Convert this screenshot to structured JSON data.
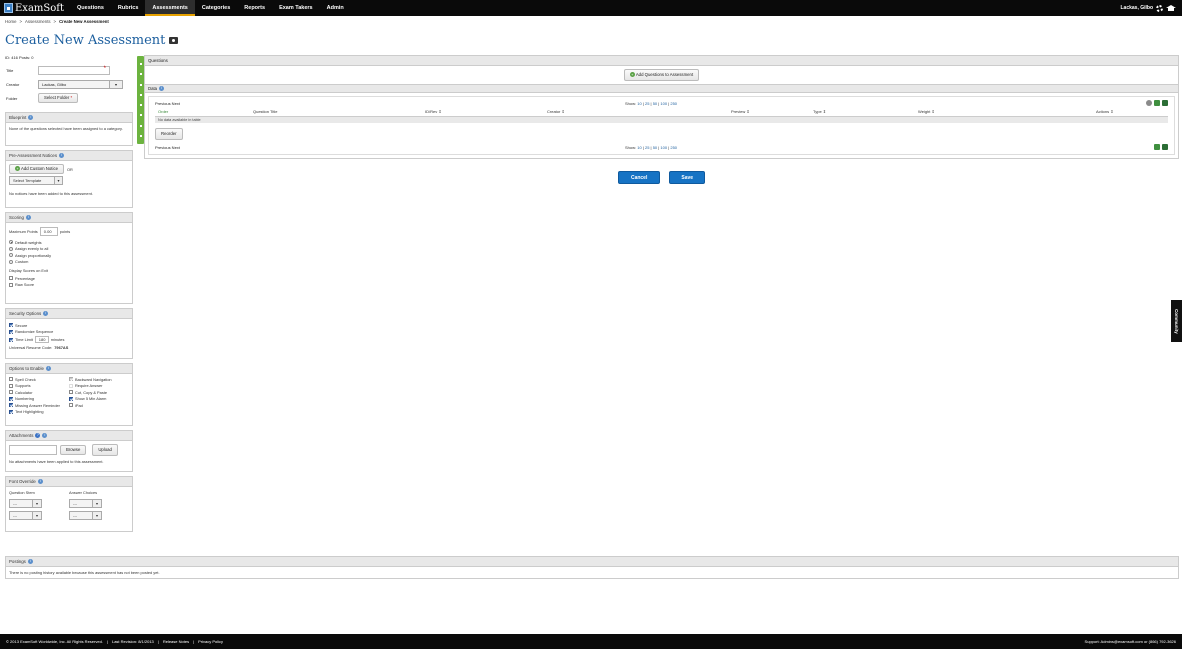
{
  "app": {
    "name": "ExamSoft"
  },
  "nav": [
    "Questions",
    "Rubrics",
    "Assessments",
    "Categories",
    "Reports",
    "Exam Takers",
    "Admin"
  ],
  "user": {
    "name": "Lackas, Gilbo"
  },
  "breadcrumb": {
    "home": "Home",
    "sep": ">",
    "assessments": "Assessments",
    "current": "Create New Assessment"
  },
  "page": {
    "title": "Create New Assessment"
  },
  "form": {
    "id_line": "ID: 416  Posts: 0",
    "title_label": "Title",
    "title_value": "",
    "creator_label": "Creator",
    "creator_value": "Lackas, Gilbo",
    "folder_label": "Folder",
    "folder_button": "Select Folder"
  },
  "blueprint": {
    "title": "Blueprint",
    "text": "None of the questions selected have been assigned to a category."
  },
  "notices": {
    "title": "Pre-Assessment Notices",
    "add_button": "Add Custom Notice",
    "or": "OR",
    "template": "Select Template",
    "empty": "No notices have been added to this assessment."
  },
  "scoring": {
    "title": "Scoring",
    "max_label": "Maximum Points",
    "max_value": "0.00",
    "points": "points",
    "radios": [
      "Default weights",
      "Assign evenly to all",
      "Assign proportionally",
      "Custom"
    ],
    "display_label": "Display Scores on Exit",
    "checks": [
      "Percentage",
      "Raw Score"
    ]
  },
  "security": {
    "title": "Security Options",
    "secure": "Secure",
    "randomize": "Randomize Sequence",
    "time_limit": "Time Limit",
    "time_value": "180",
    "minutes": "minutes",
    "resume_label": "Universal Resume Code:",
    "resume_code": "7967AS"
  },
  "enable": {
    "title": "Options to Enable",
    "left": [
      "Spell Check",
      "Supports",
      "Calculator",
      "Numbering",
      "Missing Answer Reminder",
      "Text Highlighting"
    ],
    "right": [
      "Backward Navigation",
      "Require Answer",
      "Cut, Copy & Paste",
      "Show 5 Min Alarm",
      "iPad"
    ]
  },
  "attachments": {
    "title": "Attachments",
    "browse": "Browse",
    "upload": "Upload",
    "empty": "No attachments have been applied to this assessment."
  },
  "font": {
    "title": "Font Override",
    "question_stem": "Question Stem",
    "answer_choices": "Answer Choices",
    "dash": "---"
  },
  "questions": {
    "title": "Questions",
    "add_button": "Add Questions to Assessment",
    "data_title": "Data",
    "pager": "Previous Next",
    "show_label": "Show:",
    "show_options": [
      "10",
      "25",
      "50",
      "100",
      "250"
    ],
    "columns": [
      "Order",
      "Question Title",
      "ID/Rev",
      "Creator",
      "Preview",
      "Type",
      "Weight",
      "Actions"
    ],
    "empty": "No data available in table",
    "reorder": "Reorder"
  },
  "actions": {
    "cancel": "Cancel",
    "save": "Save"
  },
  "postings": {
    "title": "Postings",
    "text": "There is no posting history available because this assessment has not been posted yet."
  },
  "footer": {
    "copyright": "© 2013 ExamSoft Worldwide, Inc. All Rights Reserved.",
    "revision": "Last Revision: 8/1/2013",
    "release": "Release Notes",
    "privacy": "Privacy Policy",
    "support": "Support: Admins@examsoft.com or (866) 792-3626"
  },
  "community": "Community"
}
